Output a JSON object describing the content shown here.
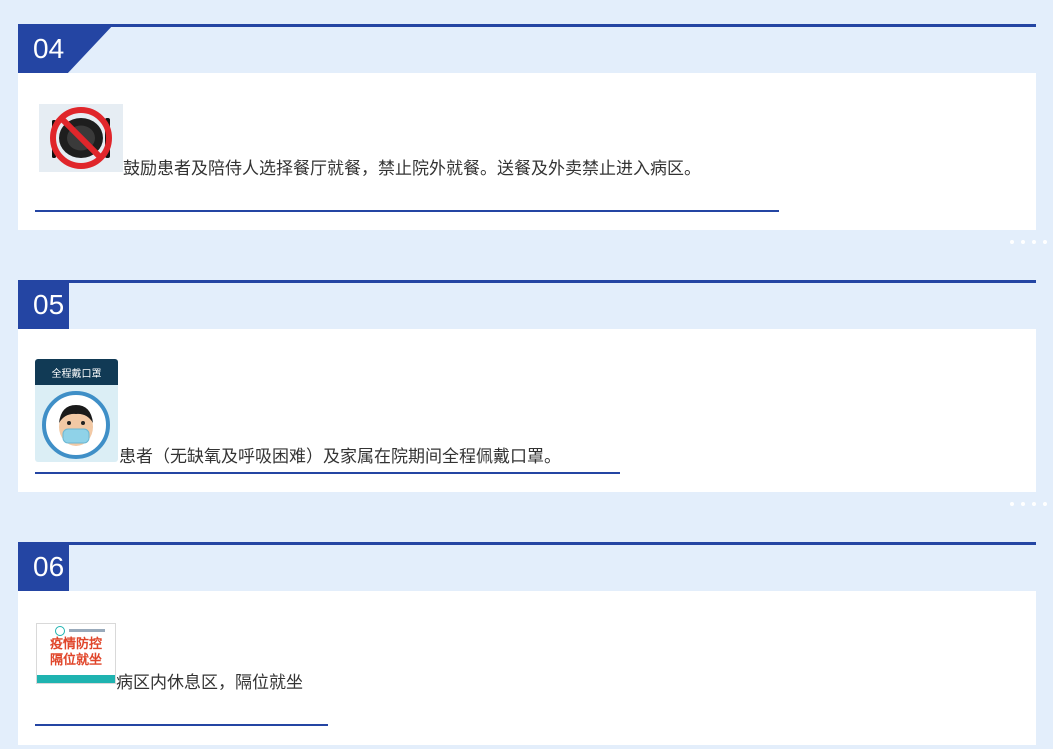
{
  "sections": [
    {
      "number": "04",
      "icon": "no-dining-icon",
      "text": "鼓励患者及陪侍人选择餐厅就餐，禁止院外就餐。送餐及外卖禁止进入病区。"
    },
    {
      "number": "05",
      "icon": "mask-icon",
      "image_title": "全程戴口罩",
      "text": "患者（无缺氧及呼吸困难）及家属在院期间全程佩戴口罩。"
    },
    {
      "number": "06",
      "icon": "epidemic-sign-icon",
      "sign_line1": "疫情防控",
      "sign_line2": "隔位就坐",
      "text": "病区内休息区，隔位就坐"
    }
  ],
  "colors": {
    "accent": "#2445a3",
    "background": "#e3eefb",
    "card": "#ffffff",
    "sign_red": "#e0452a",
    "sign_teal": "#1fb3b0"
  }
}
